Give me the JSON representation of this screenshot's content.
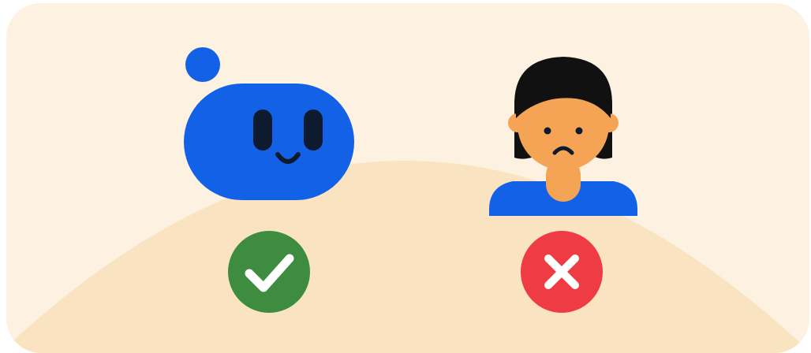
{
  "illustration": {
    "bot": {
      "icon": "smiling-bot-icon",
      "status_icon": "check-icon",
      "status": "correct"
    },
    "person": {
      "icon": "sad-person-icon",
      "status_icon": "cross-icon",
      "status": "incorrect"
    }
  },
  "colors": {
    "card_background": "#FDF1E1",
    "hill": "#FAE3C1",
    "bot_blue": "#1261E6",
    "bot_features": "#0E1B2E",
    "skin": "#F5A455",
    "hair": "#111111",
    "shirt_blue": "#1261E6",
    "check_green": "#3D8C40",
    "cross_red": "#EF3B43",
    "mark_white": "#FFFFFF"
  }
}
